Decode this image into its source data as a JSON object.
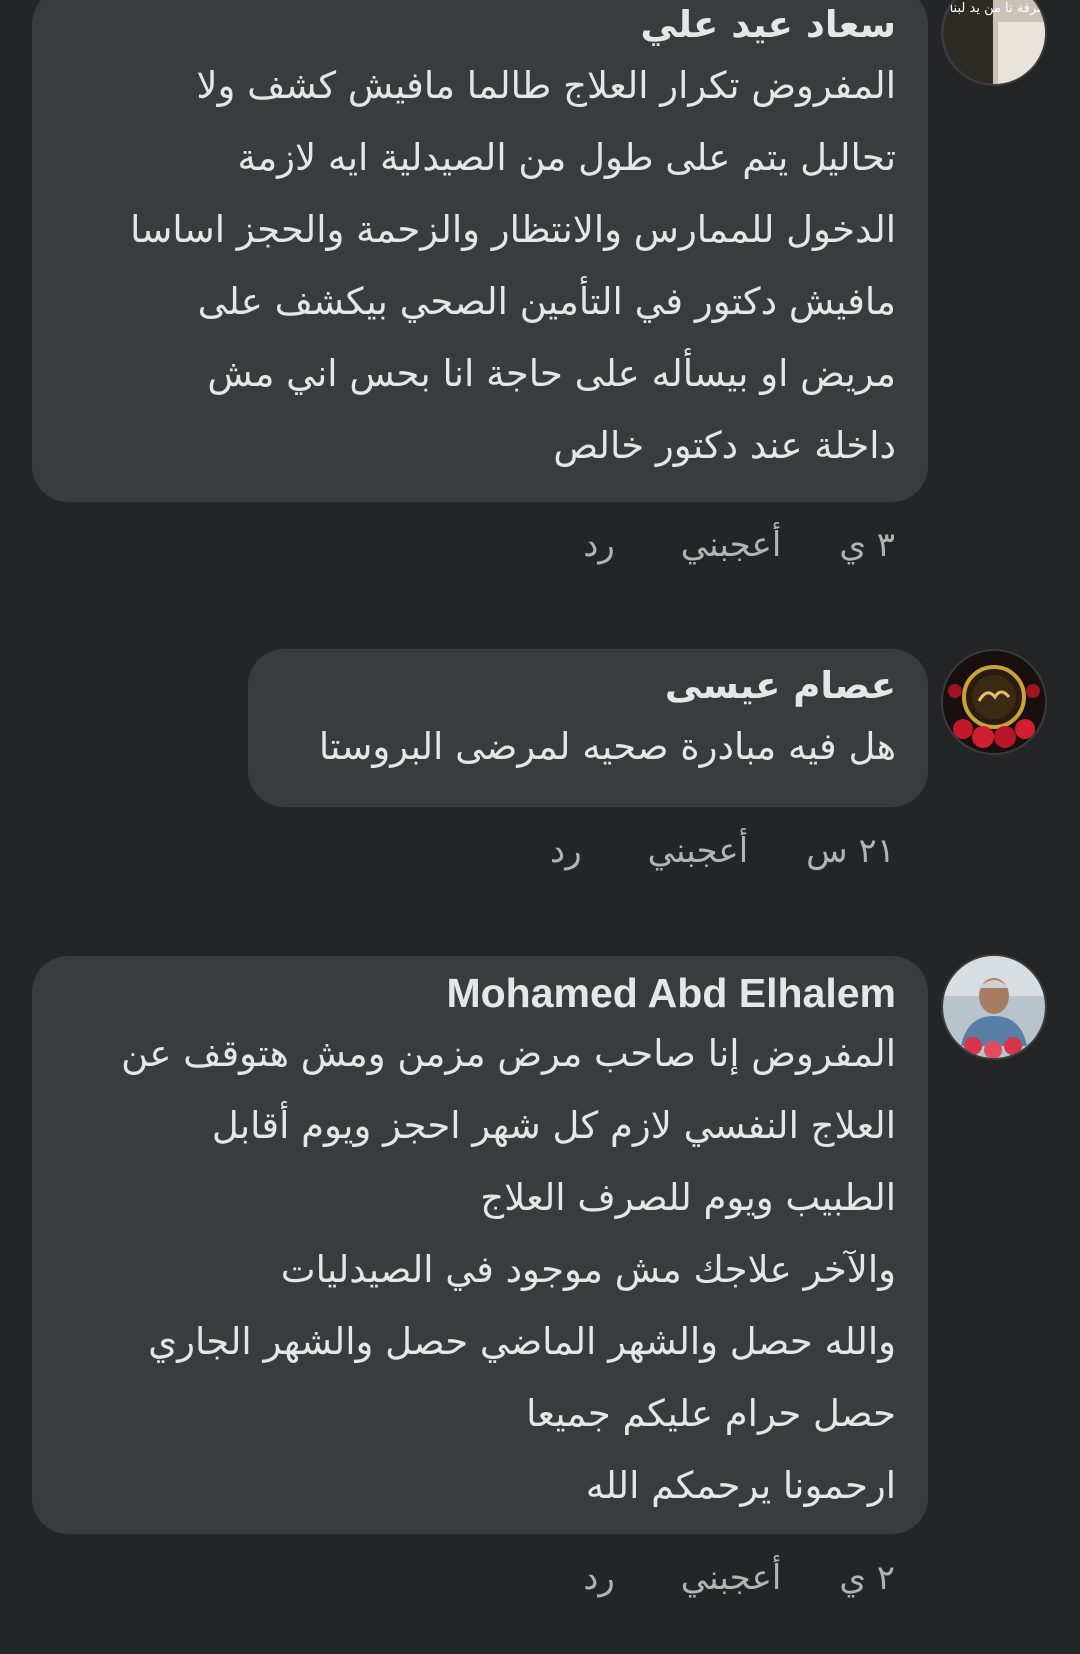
{
  "comments": [
    {
      "author": "سعاد عيد علي",
      "avatar_text": "يارب شرقة تا من يد لبنا محمد",
      "lines": [
        "المفروض تكرار العلاج طالما مافيش كشف ولا",
        "تحاليل يتم على طول من الصيدلية ايه لازمة",
        "الدخول للممارس  والانتظار والزحمة والحجز اساسا",
        "مافيش دكتور في التأمين الصحي بيكشف على",
        "مريض او بيسأله على حاجة انا بحس اني مش",
        "داخلة عند دكتور خالص"
      ],
      "time": "٣ ي",
      "like": "أعجبني",
      "reply": "رد"
    },
    {
      "author": "عصام عيسى",
      "lines": [
        "هل فيه مبادرة صحيه لمرضى البروستا"
      ],
      "time": "٢١ س",
      "like": "أعجبني",
      "reply": "رد"
    },
    {
      "author": "Mohamed Abd Elhalem",
      "lines": [
        "المفروض إنا صاحب مرض مزمن ومش هتوقف عن",
        "العلاج النفسي لازم كل شهر احجز ويوم أقابل",
        "الطبيب ويوم للصرف العلاج",
        "والآخر علاجك مش موجود في الصيدليات",
        "والله حصل والشهر الماضي حصل والشهر الجاري",
        "حصل حرام عليكم جميعا",
        "ارحمونا يرحمكم الله"
      ],
      "time": "٢ ي",
      "like": "أعجبني",
      "reply": "رد"
    }
  ],
  "colors": {
    "background": "#242526",
    "bubble": "#3a3b3c",
    "text": "#e4e6eb",
    "secondary_text": "#b0b3b8"
  }
}
